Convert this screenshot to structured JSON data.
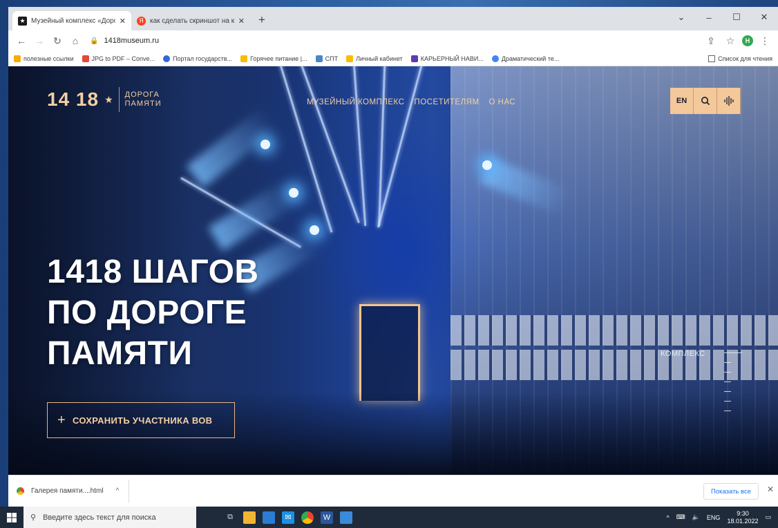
{
  "browser": {
    "tabs": [
      {
        "title": "Музейный комплекс «Дорога П",
        "active": true
      },
      {
        "title": "как сделать скриншот на компь",
        "active": false
      }
    ],
    "new_tab_label": "+",
    "url": "1418museum.ru",
    "window_controls": {
      "chevron": "⌄",
      "minimize": "–",
      "maximize": "☐",
      "close": "✕"
    },
    "bookmarks": [
      {
        "label": "полезные ссылки",
        "color": "#f9ab00"
      },
      {
        "label": "JPG to PDF – Conve...",
        "color": "#e8453c"
      },
      {
        "label": "Портал государств...",
        "color": "#3367d6"
      },
      {
        "label": "Горячее питание |...",
        "color": "#fbbc05"
      },
      {
        "label": "СПТ",
        "color": "#4a86c8"
      },
      {
        "label": "Личный кабинет",
        "color": "#fbbc05"
      },
      {
        "label": "КАРЬЕРНЫЙ НАВИ...",
        "color": "#5c3bb5"
      },
      {
        "label": "Драматический те...",
        "color": "#4285f4"
      }
    ],
    "reading_list_label": "Список для чтения",
    "avatar_letter": "H"
  },
  "site": {
    "logo": {
      "number": "14 18",
      "star": "★",
      "line1": "ДОРОГА",
      "line2": "ПАМЯТИ"
    },
    "nav": [
      "МУЗЕЙНЫЙ КОМПЛЕКС",
      "ПОСЕТИТЕЛЯМ",
      "О НАС"
    ],
    "lang_button": "EN",
    "hero": {
      "line1": "1418 ШАГОВ",
      "line2": "ПО ДОРОГЕ",
      "line3": "ПАМЯТИ"
    },
    "cta": {
      "plus": "+",
      "label": "СОХРАНИТЬ УЧАСТНИКА ВОВ"
    },
    "side_nav_label": "КОМПЛЕКС",
    "accent_color": "#f3c89a"
  },
  "downloads": {
    "file_name": "Галерея памяти....html",
    "show_all_label": "Показать все"
  },
  "taskbar": {
    "search_placeholder": "Введите здесь текст для поиска",
    "language": "ENG",
    "time": "9:30",
    "date": "18.01.2022"
  }
}
